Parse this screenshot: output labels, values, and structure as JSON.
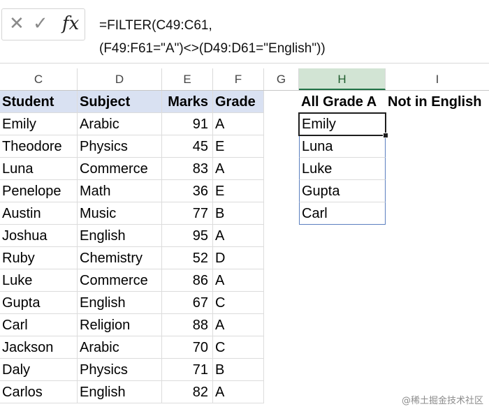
{
  "formula_bar": {
    "cancel_icon": "x-icon",
    "enter_icon": "check-icon",
    "function_icon": "fx-icon",
    "fx_label": "fx",
    "line1": "=FILTER(C49:C61,",
    "line2": "(F49:F61=\"A\")<>(D49:D61=\"English\"))"
  },
  "columns": [
    "C",
    "D",
    "E",
    "F",
    "G",
    "H",
    "I"
  ],
  "table": {
    "headers": [
      "Student",
      "Subject",
      "Marks",
      "Grade"
    ],
    "rows": [
      [
        "Emily",
        "Arabic",
        "91",
        "A"
      ],
      [
        "Theodore",
        "Physics",
        "45",
        "E"
      ],
      [
        "Luna",
        "Commerce",
        "83",
        "A"
      ],
      [
        "Penelope",
        "Math",
        "36",
        "E"
      ],
      [
        "Austin",
        "Music",
        "77",
        "B"
      ],
      [
        "Joshua",
        "English",
        "95",
        "A"
      ],
      [
        "Ruby",
        "Chemistry",
        "52",
        "D"
      ],
      [
        "Luke",
        "Commerce",
        "86",
        "A"
      ],
      [
        "Gupta",
        "English",
        "67",
        "C"
      ],
      [
        "Carl",
        "Religion",
        "88",
        "A"
      ],
      [
        "Jackson",
        "Arabic",
        "70",
        "C"
      ],
      [
        "Daly",
        "Physics",
        "71",
        "B"
      ],
      [
        "Carlos",
        "English",
        "82",
        "A"
      ]
    ]
  },
  "result": {
    "header_h": "All Grade A",
    "header_i": "Not in English",
    "values": [
      "Emily",
      "Luna",
      "Luke",
      "Gupta",
      "Carl"
    ]
  },
  "watermark": "@稀土掘金技术社区",
  "colors": {
    "header_fill": "#d9e1f2",
    "active_column_fill": "#d2e4d4",
    "result_border": "#5b7fbf"
  }
}
